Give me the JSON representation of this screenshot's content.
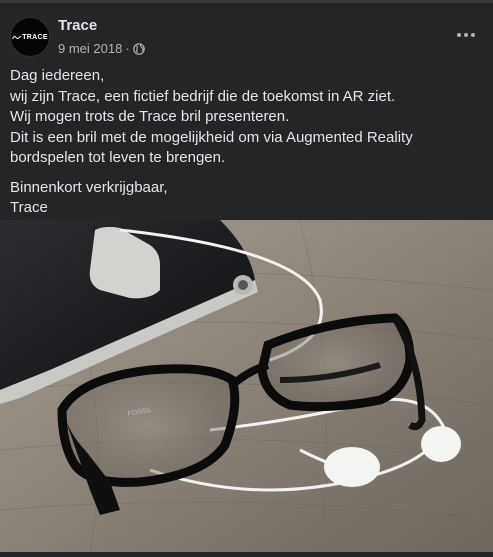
{
  "post": {
    "page_name": "Trace",
    "avatar_text": "TRACE",
    "date": "9 mei 2018",
    "separator": "·",
    "privacy_icon": "globe-icon",
    "more_icon": "more-dots-icon",
    "paragraphs": [
      {
        "lines": [
          "Dag iedereen,",
          "wij zijn Trace, een fictief bedrijf die de toekomst in AR ziet.",
          "Wij mogen trots de Trace bril presenteren.",
          "Dit is een bril met de mogelijkheid om via Augmented Reality",
          "bordspelen tot leven te brengen."
        ]
      },
      {
        "lines": [
          "Binnenkort verkrijgbaar,",
          "Trace"
        ]
      }
    ],
    "photo_alt_icon": "glasses-photo",
    "temple_text": "FOSSIL"
  },
  "colors": {
    "card_bg": "#242526",
    "text_primary": "#e4e6eb",
    "text_secondary": "#b0b3b8"
  }
}
